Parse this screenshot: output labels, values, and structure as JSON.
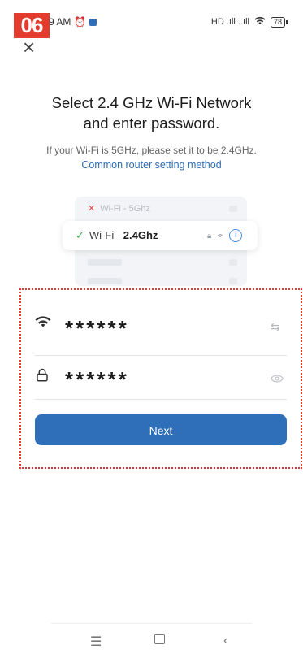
{
  "step_badge": "06",
  "status_bar": {
    "time": "9 AM",
    "signal_text": "HD .ıll ..ıll",
    "battery": "78"
  },
  "header": {
    "title_line1": "Select 2.4 GHz Wi-Fi Network",
    "title_line2": "and enter password.",
    "subtitle": "If your Wi-Fi is 5GHz, please set it to be 2.4GHz.",
    "link": "Common router setting method"
  },
  "illustration": {
    "wifi_5ghz_label": "Wi-Fi - 5Ghz",
    "wifi_24_prefix": "Wi-Fi - ",
    "wifi_24_band": "2.4Ghz"
  },
  "form": {
    "wifi_name_value": "******",
    "password_value": "******",
    "next_label": "Next"
  },
  "icons": {
    "close": "close-icon",
    "wifi": "wifi-icon",
    "lock": "lock-icon",
    "switch": "switch-network-icon",
    "eye": "eye-icon"
  },
  "colors": {
    "accent": "#2f6eb8",
    "link": "#2f6db3",
    "badge": "#e33b2e",
    "highlight": "#e23a33"
  }
}
